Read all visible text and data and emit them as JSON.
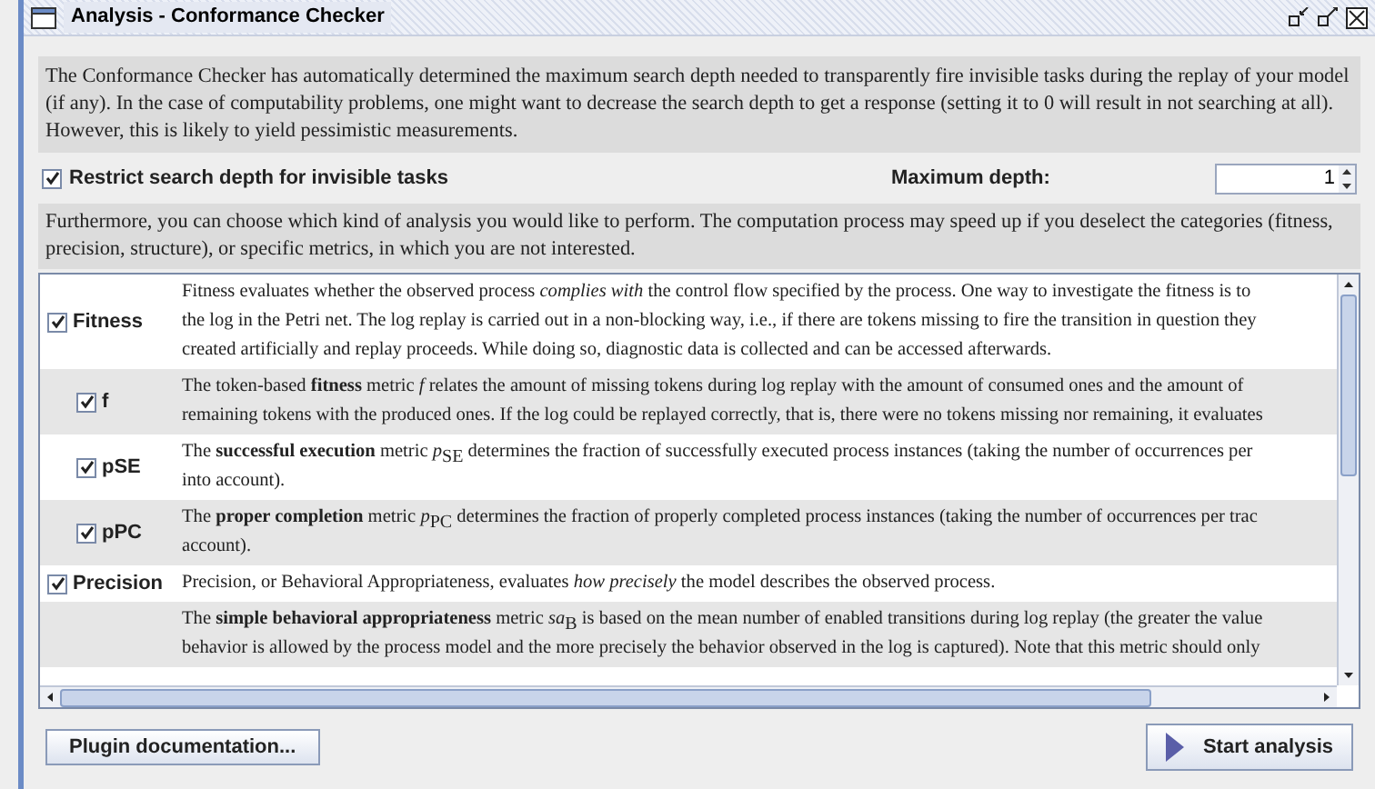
{
  "window": {
    "title": "Analysis - Conformance Checker"
  },
  "intro": "The Conformance Checker has automatically determined the maximum search depth needed to transparently fire invisible tasks during the replay of your model (if any). In the case of computability problems, one might want to decrease the search depth to get a response (setting it to 0 will result in not searching at all). However, this is likely to yield pessimistic measurements.",
  "restrict": {
    "label": "Restrict search depth for invisible tasks",
    "checked": true
  },
  "max_depth": {
    "label": "Maximum depth:",
    "value": "1"
  },
  "info": "Furthermore, you can choose which kind of analysis you would like to perform. The computation process may speed up if you deselect the categories (fitness, precision, structure), or specific metrics, in which you are not interested.",
  "categories": [
    {
      "label": "Fitness",
      "checked": true,
      "lines": [
        "Fitness evaluates whether the observed process *complies with* the control flow specified by the process. One way to investigate the fitness is to",
        "the log in the Petri net. The log replay is carried out in a non-blocking way, i.e., if there are tokens missing to fire the transition in question they",
        "created artificially and replay proceeds. While doing so, diagnostic data is collected and can be accessed afterwards."
      ],
      "children": [
        {
          "label": "f",
          "checked": true,
          "lines": [
            "The token-based **fitness** metric *f* relates the amount of missing tokens during log replay with the amount of consumed ones and the amount of",
            "remaining tokens with the produced ones. If the log could be replayed correctly, that is, there were no tokens missing nor remaining, it evaluates"
          ]
        },
        {
          "label": "pSE",
          "checked": true,
          "lines": [
            "The **successful execution** metric *p*$_{SE}$ determines the fraction of successfully executed process instances (taking the number of occurrences per",
            "into account)."
          ]
        },
        {
          "label": "pPC",
          "checked": true,
          "lines": [
            "The **proper completion** metric *p*$_{PC}$ determines the fraction of properly completed process instances (taking the number of occurrences per trac",
            "account)."
          ]
        }
      ]
    },
    {
      "label": "Precision",
      "checked": true,
      "lines": [
        "Precision, or Behavioral Appropriateness, evaluates *how precisely* the model describes the observed process."
      ],
      "children": [
        {
          "lines": [
            "The **simple behavioral appropriateness** metric *sa*$_{B}$ is based on the mean number of enabled transitions during log replay (the greater the value",
            "behavior is allowed by the process model and the more precisely the behavior observed in the log is captured). Note that this metric should only"
          ]
        }
      ]
    }
  ],
  "buttons": {
    "documentation": "Plugin documentation...",
    "start": "Start analysis"
  }
}
